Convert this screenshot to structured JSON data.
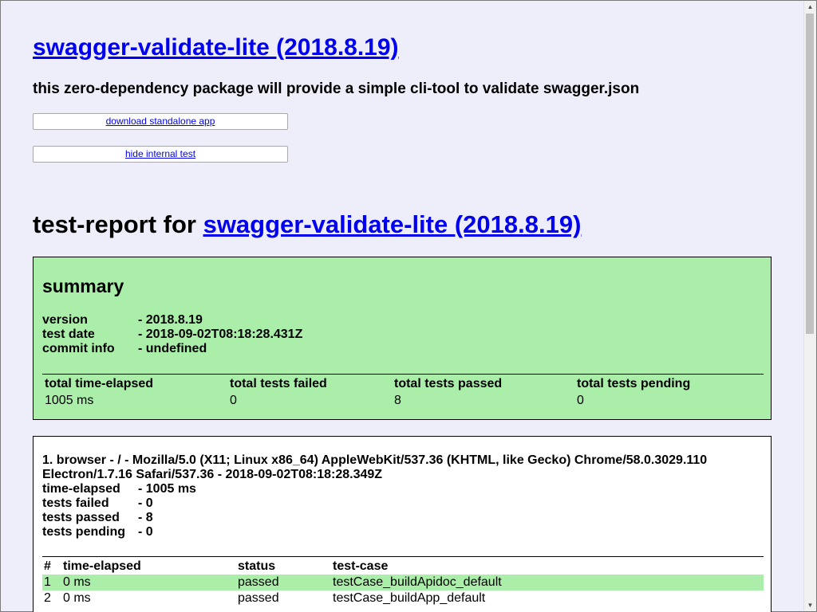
{
  "header": {
    "title": "swagger-validate-lite (2018.8.19)",
    "description": "this zero-dependency package will provide a simple cli-tool to validate swagger.json",
    "download_label": "download standalone app",
    "hide_label": "hide internal test"
  },
  "report": {
    "prefix": "test-report for ",
    "link_title": "swagger-validate-lite (2018.8.19)"
  },
  "summary": {
    "heading": "summary",
    "fields": [
      {
        "key": "version",
        "value": "- 2018.8.19"
      },
      {
        "key": "test date",
        "value": "- 2018-09-02T08:18:28.431Z"
      },
      {
        "key": "commit info",
        "value": "- undefined"
      }
    ],
    "totals_headers": [
      "total time-elapsed",
      "total tests failed",
      "total tests passed",
      "total tests pending"
    ],
    "totals_values": [
      "1005 ms",
      "0",
      "8",
      "0"
    ]
  },
  "browser": {
    "title_line": "1. browser - / - Mozilla/5.0 (X11; Linux x86_64) AppleWebKit/537.36 (KHTML, like Gecko) Chrome/58.0.3029.110 Electron/1.7.16 Safari/537.36 - 2018-09-02T08:18:28.349Z",
    "fields": [
      {
        "key": "time-elapsed",
        "value": "- 1005 ms"
      },
      {
        "key": "tests failed",
        "value": "- 0"
      },
      {
        "key": "tests passed",
        "value": "- 8"
      },
      {
        "key": "tests pending",
        "value": "- 0"
      }
    ],
    "table_headers": [
      "#",
      "time-elapsed",
      "status",
      "test-case"
    ],
    "rows": [
      {
        "num": "1",
        "time": "0 ms",
        "status": "passed",
        "case": "testCase_buildApidoc_default"
      },
      {
        "num": "2",
        "time": "0 ms",
        "status": "passed",
        "case": "testCase_buildApp_default"
      }
    ]
  },
  "colors": {
    "background": "#eeeefb",
    "passed": "#aaeeaa",
    "link": "#0000ee"
  }
}
